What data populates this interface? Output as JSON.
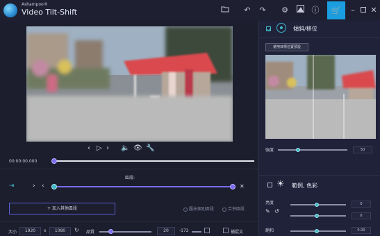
{
  "app": {
    "brand": "Ashampoo®",
    "title": "Video Tilt-Shift"
  },
  "titlebar_icons": [
    "folder-icon",
    "undo-icon",
    "redo-icon",
    "gear-icon",
    "image-icon",
    "info-icon",
    "cart-icon",
    "minimize-icon",
    "maximize-icon",
    "close-icon"
  ],
  "player": {
    "timecode": "00:00:00.000",
    "progress": 0.0
  },
  "section": {
    "label": "區段:"
  },
  "buttons": {
    "add_section": "加入其他區段"
  },
  "radios": {
    "option1": "匯出個別區段",
    "option2": "合併區段"
  },
  "bottom": {
    "size_label": "大小",
    "width": "1920",
    "x": "x",
    "height": "1080",
    "quality_label": "品質",
    "quality_value": "20",
    "pos_value": "-172",
    "checkbox_label": "捕捉文"
  },
  "right_panel": {
    "title": "傾斜/移位",
    "reset_button": "使用目標位置預設",
    "strength_label": "強度",
    "strength_value": "50",
    "section2_title": "範例, 色彩",
    "rows": [
      {
        "label": "亮度",
        "value": "0"
      },
      {
        "label": "",
        "value": "0"
      },
      {
        "label": "飽和",
        "value": "0.00"
      }
    ]
  },
  "colors": {
    "accent": "#7c6cf0",
    "cart": "#1a9ee0",
    "teal": "#3fb8c7"
  }
}
